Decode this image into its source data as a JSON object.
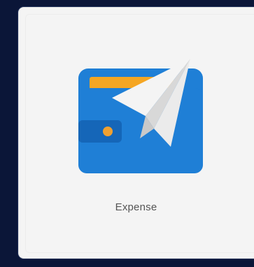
{
  "app_tile": {
    "label": "Expense",
    "icon": "wallet-paper-plane-icon",
    "colors": {
      "wallet_blue": "#1f7fd6",
      "wallet_blue_dark": "#1566b8",
      "wallet_card_orange": "#f5a623",
      "clasp_dot": "#f0a030",
      "plane_white": "#f2f2f2",
      "plane_shadow": "#cfcfcf",
      "tile_background": "#f4f4f4",
      "screen_background": "#0b1638"
    }
  }
}
